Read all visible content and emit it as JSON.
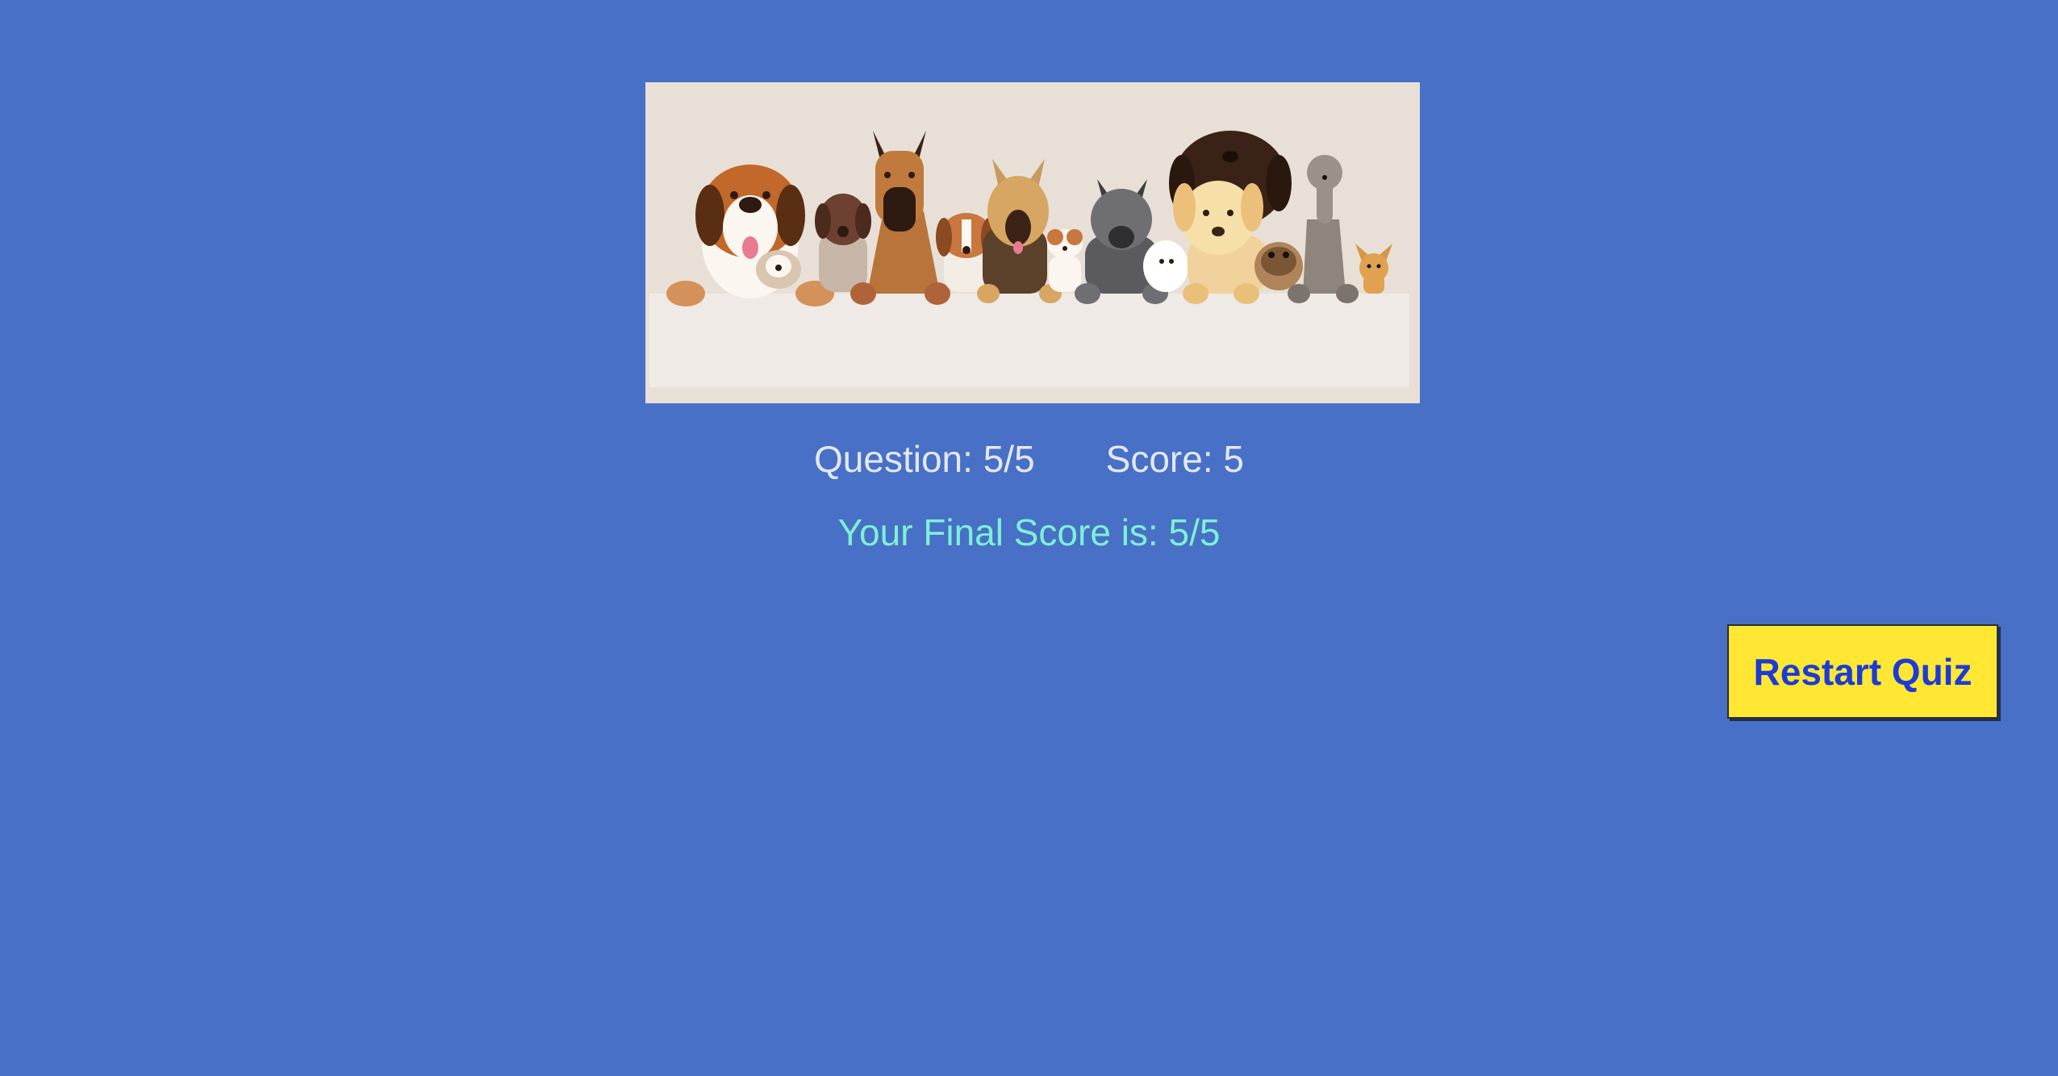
{
  "banner": {
    "image_name": "dog-breeds-illustration"
  },
  "status": {
    "question_label": "Question: 5/5",
    "score_label": "Score: 5"
  },
  "result": {
    "final_score_text": "Your Final Score is: 5/5"
  },
  "actions": {
    "restart_label": "Restart Quiz"
  },
  "colors": {
    "page_background": "#4870c6",
    "status_text": "#e3e8f4",
    "final_score_text": "#7df0d4",
    "button_background": "#ffe733",
    "button_text": "#1c3bd6"
  }
}
